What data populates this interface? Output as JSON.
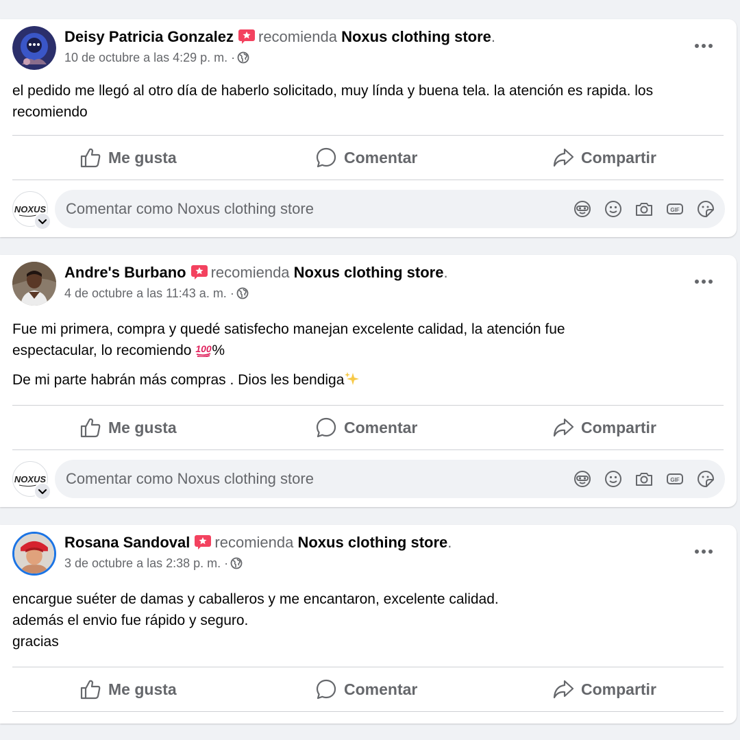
{
  "colors": {
    "background": "#f0f2f5",
    "card": "#ffffff",
    "text": "#050505",
    "secondary_text": "#65676b",
    "recommend_badge": "#f3425f",
    "divider": "#ced0d4"
  },
  "actions": {
    "like_label": "Me gusta",
    "comment_label": "Comentar",
    "share_label": "Compartir"
  },
  "comment_composer": {
    "placeholder": "Comentar como Noxus clothing store",
    "page_avatar_text": "NOXUS",
    "tools": [
      "avatar-sticker-icon",
      "emoji-icon",
      "camera-icon",
      "gif-icon",
      "sticker-icon"
    ]
  },
  "reviews": [
    {
      "author": "Deisy Patricia Gonzalez",
      "verb": "recomienda",
      "page": "Noxus clothing store",
      "end_mark": ".",
      "time": "10 de octubre a las 4:29 p. m. ·",
      "privacy_icon": "globe-icon",
      "body": [
        "el pedido me llegó al otro día de haberlo solicitado, muy línda y buena tela. la atención es rapida. los recomiendo"
      ]
    },
    {
      "author": "Andre's Burbano",
      "verb": "recomienda",
      "page": "Noxus clothing store",
      "end_mark": ".",
      "time": "4 de octubre a las 11:43 a. m. ·",
      "privacy_icon": "globe-icon",
      "body_line1": "Fue mi primera, compra y quedé satisfecho manejan excelente calidad, la atención fue espectacular, lo recomiendo",
      "body_line1_suffix": "%",
      "body_line2": "De mi parte habrán más compras . Dios les bendiga"
    },
    {
      "author": "Rosana Sandoval",
      "verb": "recomienda",
      "page": "Noxus clothing store",
      "end_mark": ".",
      "time": "3 de octubre a las 2:38 p. m. ·",
      "privacy_icon": "globe-icon",
      "body": [
        "encargue suéter de damas y caballeros y me encantaron, excelente calidad.",
        "además el envio fue rápido y seguro.",
        "gracias"
      ]
    }
  ]
}
